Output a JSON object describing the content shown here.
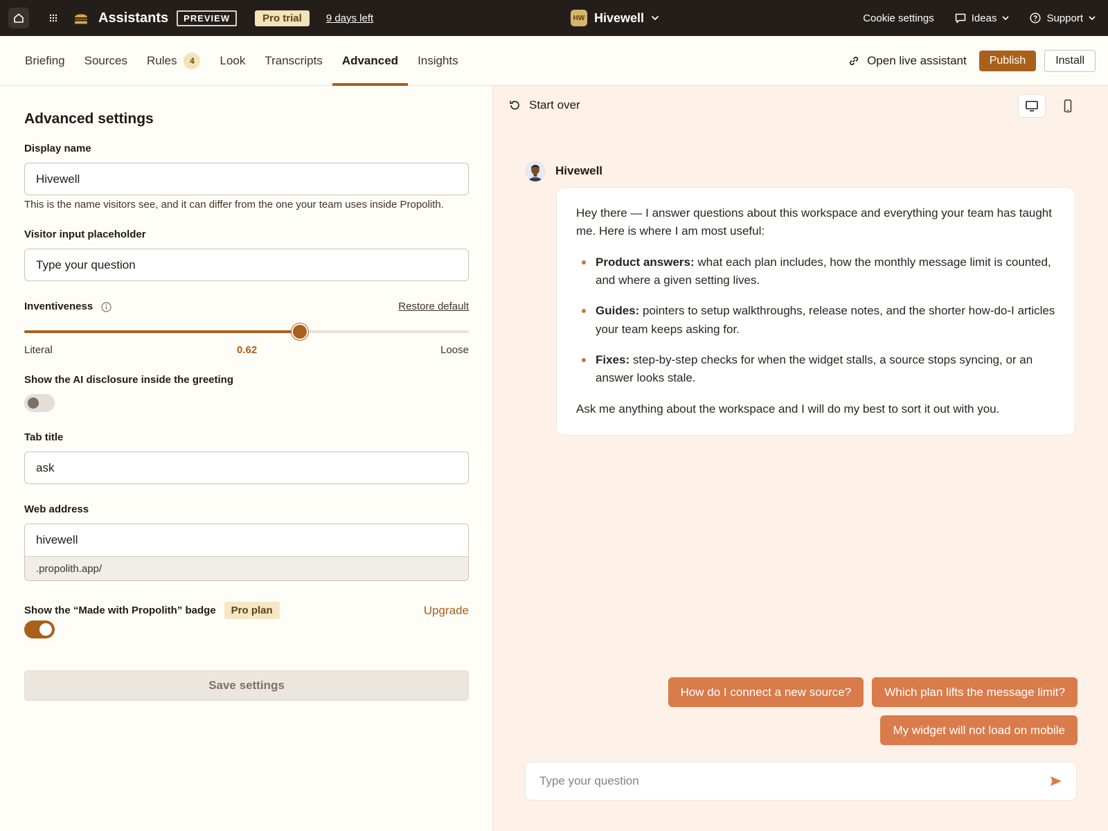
{
  "topbar": {
    "brand": "Assistants",
    "preview_badge": "PREVIEW",
    "trial_badge": "Pro trial",
    "days_left": "9 days left",
    "workspace_initials": "HW",
    "workspace_name": "Hivewell",
    "cookie_settings": "Cookie settings",
    "ideas": "Ideas",
    "support": "Support"
  },
  "tabs": [
    {
      "label": "Briefing"
    },
    {
      "label": "Sources"
    },
    {
      "label": "Rules",
      "count": "4"
    },
    {
      "label": "Look"
    },
    {
      "label": "Transcripts"
    },
    {
      "label": "Advanced",
      "active": true
    },
    {
      "label": "Insights"
    }
  ],
  "tab_actions": {
    "open_live": "Open live assistant",
    "publish": "Publish",
    "install": "Install"
  },
  "settings": {
    "title": "Advanced settings",
    "display_name": {
      "label": "Display name",
      "value": "Hivewell",
      "hint": "This is the name visitors see, and it can differ from the one your team uses inside Propolith."
    },
    "placeholder": {
      "label": "Visitor input placeholder",
      "value": "Type your question"
    },
    "inventiveness": {
      "label": "Inventiveness",
      "restore": "Restore default",
      "value": 0.62,
      "value_label": "0.62",
      "min_label": "Literal",
      "max_label": "Loose"
    },
    "disclosure": {
      "label": "Show the AI disclosure inside the greeting",
      "enabled": false
    },
    "tab_title": {
      "label": "Tab title",
      "value": "ask"
    },
    "web_address": {
      "label": "Web address",
      "value": "hivewell",
      "suffix": ".propolith.app/"
    },
    "badge": {
      "label": "Show the “Made with Propolith” badge",
      "plan": "Pro plan",
      "upgrade": "Upgrade",
      "enabled": true
    },
    "save": "Save settings"
  },
  "preview": {
    "start_over": "Start over",
    "bot_name": "Hivewell",
    "greeting": "Hey there — I answer questions about this workspace and everything your team has taught me. Here is where I am most useful:",
    "bullets": [
      {
        "title": "Product answers:",
        "text": " what each plan includes, how the monthly message limit is counted, and where a given setting lives."
      },
      {
        "title": "Guides:",
        "text": " pointers to setup walkthroughs, release notes, and the shorter how-do-I articles your team keeps asking for."
      },
      {
        "title": "Fixes:",
        "text": " step-by-step checks for when the widget stalls, a source stops syncing, or an answer looks stale."
      }
    ],
    "closing": "Ask me anything about the workspace and I will do my best to sort it out with you.",
    "suggestions": [
      "How do I connect a new source?",
      "Which plan lifts the message limit?",
      "My widget will not load on mobile"
    ],
    "composer_placeholder": "Type your question"
  },
  "colors": {
    "accent": "#a8601a",
    "chip": "#d97b4a",
    "topbar": "#231e1a",
    "preview_bg": "#fdf1e8"
  }
}
